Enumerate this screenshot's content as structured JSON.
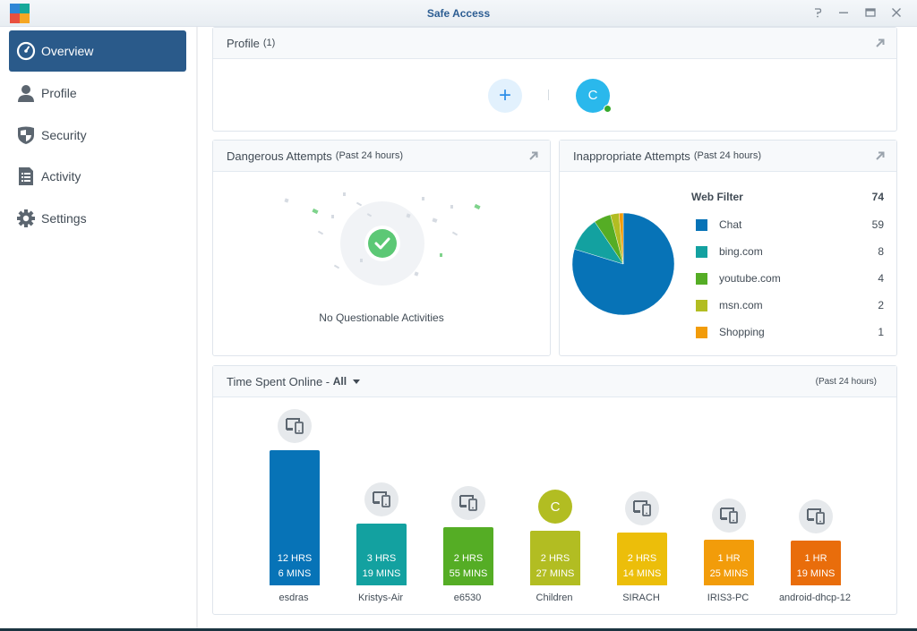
{
  "window": {
    "title": "Safe Access",
    "controls": [
      "help",
      "minimize",
      "maximize",
      "close"
    ]
  },
  "sidebar": {
    "items": [
      {
        "label": "Overview",
        "icon": "dashboard-gauge-icon",
        "active": true
      },
      {
        "label": "Profile",
        "icon": "user-icon",
        "active": false
      },
      {
        "label": "Security",
        "icon": "shield-icon",
        "active": false
      },
      {
        "label": "Activity",
        "icon": "list-document-icon",
        "active": false
      },
      {
        "label": "Settings",
        "icon": "gear-icon",
        "active": false
      }
    ]
  },
  "profile_card": {
    "title": "Profile",
    "count": "(1)",
    "add_label": "+",
    "profiles": [
      {
        "initial": "C",
        "color": "#2ab8ec",
        "online": true
      }
    ]
  },
  "dangerous_card": {
    "title": "Dangerous Attempts",
    "period": "(Past 24 hours)",
    "empty_message": "No Questionable Activities"
  },
  "inappropriate_card": {
    "title": "Inappropriate Attempts",
    "period": "(Past 24 hours)",
    "legend_header": "Web Filter",
    "legend_total": "74"
  },
  "time_card": {
    "title": "Time Spent Online - ",
    "filter": "All",
    "period": "(Past 24 hours)"
  },
  "chart_data": [
    {
      "type": "pie",
      "title": "Web Filter",
      "total": 74,
      "categories": [
        "Chat",
        "bing.com",
        "youtube.com",
        "msn.com",
        "Shopping"
      ],
      "values": [
        59,
        8,
        4,
        2,
        1
      ],
      "colors": [
        "#0773b7",
        "#13a1a0",
        "#55ad25",
        "#b2bd22",
        "#f29c0a"
      ],
      "legend": "right"
    },
    {
      "type": "bar",
      "title": "Time Spent Online",
      "categories": [
        "esdras",
        "Kristys-Air",
        "e6530",
        "Children",
        "SIRACH",
        "IRIS3-PC",
        "android-dhcp-12"
      ],
      "values_minutes": [
        726,
        199,
        175,
        147,
        134,
        85,
        79
      ],
      "labels": [
        [
          "12 HRS",
          "6 MINS"
        ],
        [
          "3 HRS",
          "19 MINS"
        ],
        [
          "2 HRS",
          "55 MINS"
        ],
        [
          "2 HRS",
          "27 MINS"
        ],
        [
          "2 HRS",
          "14 MINS"
        ],
        [
          "1 HR",
          "25 MINS"
        ],
        [
          "1 HR",
          "19 MINS"
        ]
      ],
      "colors": [
        "#0773b7",
        "#13a1a0",
        "#55ad25",
        "#b2bd22",
        "#ecbe0a",
        "#f29c0a",
        "#e96d0b"
      ],
      "icons": [
        "devices-icon",
        "devices-icon",
        "devices-icon",
        "profile-initial",
        "devices-icon",
        "devices-icon",
        "devices-icon"
      ],
      "profile_initial": "C"
    }
  ]
}
